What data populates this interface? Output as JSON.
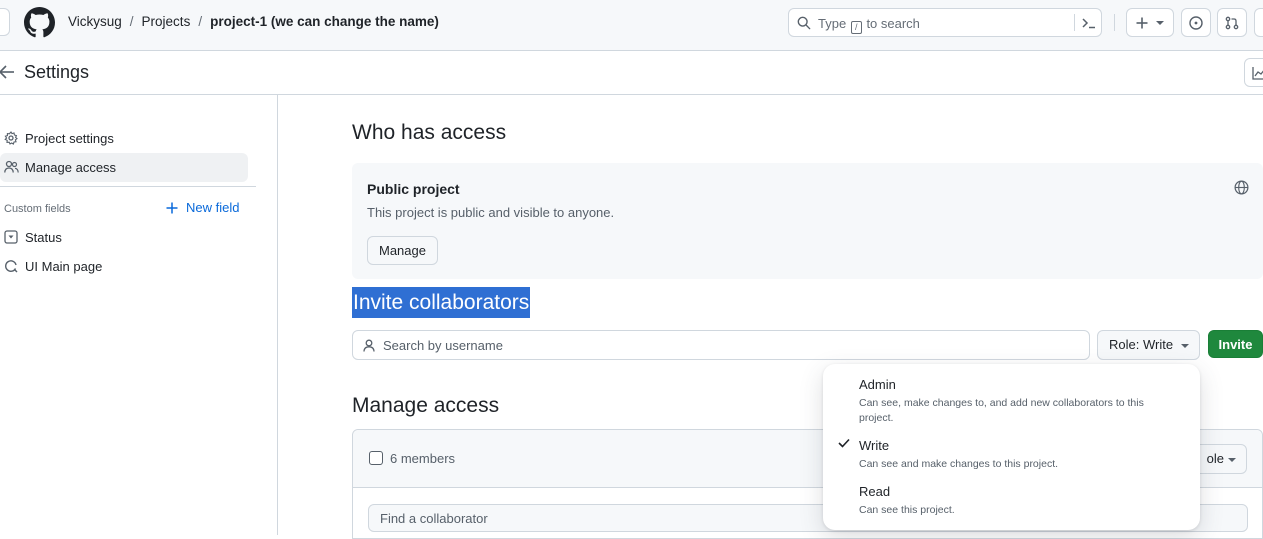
{
  "header": {
    "breadcrumbs": [
      "Vickysug",
      "Projects",
      "project-1 (we can change the name)"
    ],
    "search_placeholder_pre": "Type",
    "search_key": "/",
    "search_placeholder_post": "to search"
  },
  "settings_bar": {
    "title": "Settings"
  },
  "sidebar": {
    "items": [
      {
        "label": "Project settings",
        "icon": "gear-icon"
      },
      {
        "label": "Manage access",
        "icon": "people-icon"
      }
    ],
    "custom_fields_label": "Custom fields",
    "new_field_label": "New field",
    "fields": [
      {
        "label": "Status",
        "icon": "single-select-icon"
      },
      {
        "label": "UI Main page",
        "icon": "iteration-icon"
      }
    ]
  },
  "main": {
    "who_has_access_title": "Who has access",
    "public": {
      "title": "Public project",
      "description": "This project is public and visible to anyone.",
      "manage_label": "Manage"
    },
    "invite_title": "Invite collaborators",
    "user_search_placeholder": "Search by username",
    "role_button_label": "Role: Write",
    "invite_button_label": "Invite",
    "manage_access_title": "Manage access",
    "members_count": "6 members",
    "role_filter_label": "ole",
    "find_placeholder": "Find a collaborator"
  },
  "role_dropdown": {
    "options": [
      {
        "title": "Admin",
        "description": "Can see, make changes to, and add new collaborators to this project.",
        "selected": false
      },
      {
        "title": "Write",
        "description": "Can see and make changes to this project.",
        "selected": true
      },
      {
        "title": "Read",
        "description": "Can see this project.",
        "selected": false
      }
    ]
  },
  "colors": {
    "accent": "#0969da",
    "primary_button": "#1f883d",
    "selection_highlight": "#2f6fd3"
  }
}
